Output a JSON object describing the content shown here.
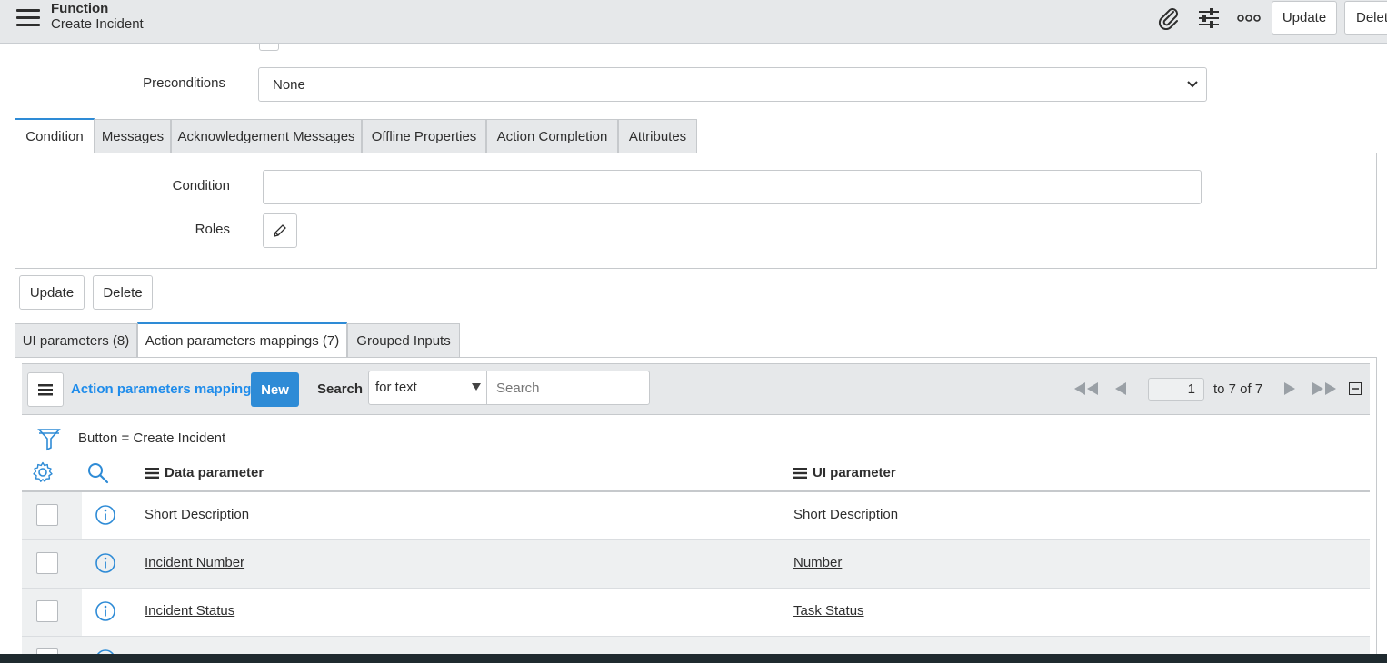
{
  "header": {
    "title": "Function",
    "subtitle": "Create Incident",
    "update_label": "Update",
    "delete_label": "Delet"
  },
  "form": {
    "preconditions_label": "Preconditions",
    "preconditions_value": "None"
  },
  "form_tabs": [
    {
      "label": "Condition",
      "active": true
    },
    {
      "label": "Messages",
      "active": false
    },
    {
      "label": "Acknowledgement Messages",
      "active": false
    },
    {
      "label": "Offline Properties",
      "active": false
    },
    {
      "label": "Action Completion",
      "active": false
    },
    {
      "label": "Attributes",
      "active": false
    }
  ],
  "condition_panel": {
    "condition_label": "Condition",
    "condition_value": "",
    "roles_label": "Roles"
  },
  "form_buttons": {
    "update_label": "Update",
    "delete_label": "Delete"
  },
  "related_tabs": [
    {
      "label": "UI parameters (8)",
      "active": false
    },
    {
      "label": "Action parameters mappings (7)",
      "active": true
    },
    {
      "label": "Grouped Inputs",
      "active": false
    }
  ],
  "list": {
    "title": "Action parameters mappings",
    "new_label": "New",
    "search_label": "Search",
    "search_field_value": "for text",
    "search_placeholder": "Search",
    "page_value": "1",
    "page_range": "to 7 of 7",
    "filter_text": "Button = Create Incident",
    "columns": [
      "Data parameter",
      "UI parameter"
    ],
    "rows": [
      {
        "data_parameter": "Short Description",
        "ui_parameter": "Short Description"
      },
      {
        "data_parameter": "Incident Number",
        "ui_parameter": "Number"
      },
      {
        "data_parameter": "Incident Status",
        "ui_parameter": "Task Status"
      }
    ]
  },
  "colors": {
    "accent": "#2e8bd6",
    "header_bg": "#e6e8ea",
    "link_blue": "#1f8ceb"
  }
}
